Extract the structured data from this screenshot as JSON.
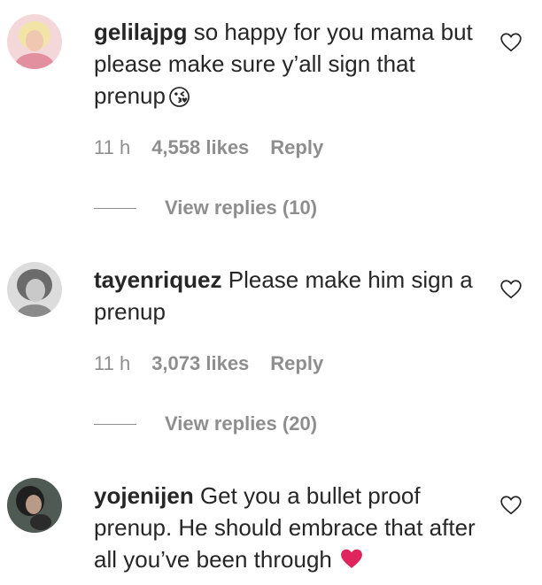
{
  "comments": [
    {
      "username": "gelilajpg",
      "text": "so happy for you mama but please make sure y’all sign that prenup",
      "emoji": "😘",
      "time": "11 h",
      "likes": "4,558 likes",
      "reply": "Reply",
      "view_replies": "View replies (10)"
    },
    {
      "username": "tayenriquez",
      "text": "Please make him sign a prenup",
      "time": "11 h",
      "likes": "3,073 likes",
      "reply": "Reply",
      "view_replies": "View replies (20)"
    },
    {
      "username": "yojenijen",
      "text": "Get you a bullet proof prenup. He should embrace that after all you’ve been through",
      "emoji": "❤️"
    }
  ],
  "icons": {
    "like": "heart-outline-icon"
  },
  "colors": {
    "text": "#262626",
    "secondary": "#8e8e8e",
    "heart_emoji": "#e0245e"
  }
}
